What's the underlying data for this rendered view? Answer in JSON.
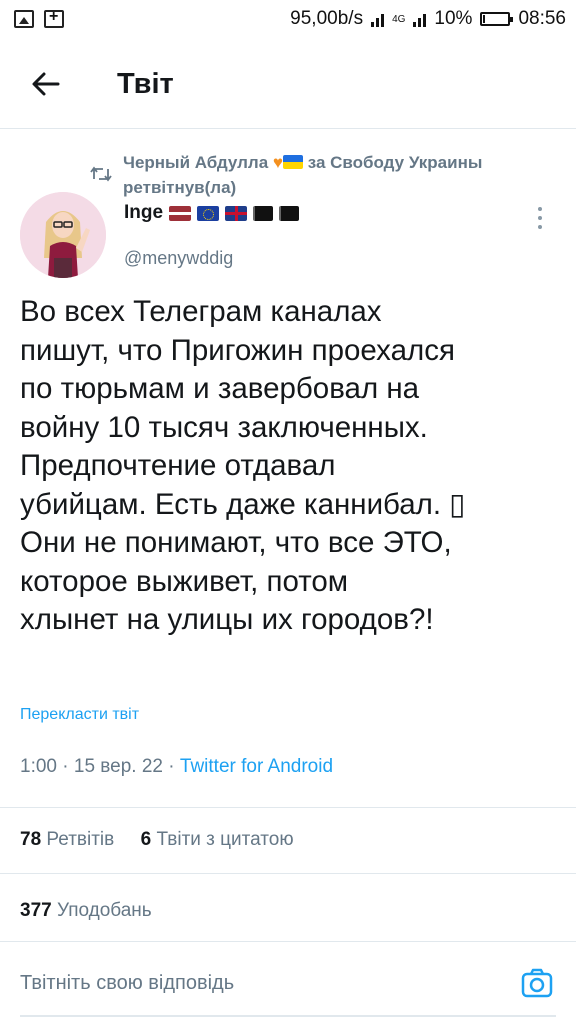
{
  "statusbar": {
    "speed": "95,00b/s",
    "network": "4G",
    "battery": "10%",
    "battery_level": 0.1,
    "time": "08:56"
  },
  "header": {
    "title": "Твіт"
  },
  "retweet": {
    "user": "Черный Абдулла",
    "suffix": "за Свободу Украины",
    "action": "ретвітнув(ла)"
  },
  "author": {
    "name": "Inge",
    "handle": "@menywddig"
  },
  "tweet": {
    "lines": [
      "Во всех Телеграм каналах",
      "пишут, что Пригожин проехался",
      "по тюрьмам и завербовал на",
      "войну 10 тысяч заключенных.",
      "Предпочтение отдавал",
      "убийцам. Есть даже каннибал. ▯",
      "Они не понимают, что все ЭТО,",
      "которое выживет, потом",
      "хлынет на улицы их городов?!"
    ],
    "translate_label": "Перекласти твіт",
    "time": "1:00",
    "date": "15 вер. 22",
    "source": "Twitter for Android"
  },
  "stats": {
    "retweets_count": "78",
    "retweets_label": "Ретвітів",
    "quotes_count": "6",
    "quotes_label": "Твіти з цитатою",
    "likes_count": "377",
    "likes_label": "Уподобань"
  },
  "reply": {
    "placeholder": "Твітніть свою відповідь"
  },
  "colors": {
    "accent": "#1da1f2",
    "secondary_text": "#657786",
    "divider": "#e1e8ed"
  }
}
